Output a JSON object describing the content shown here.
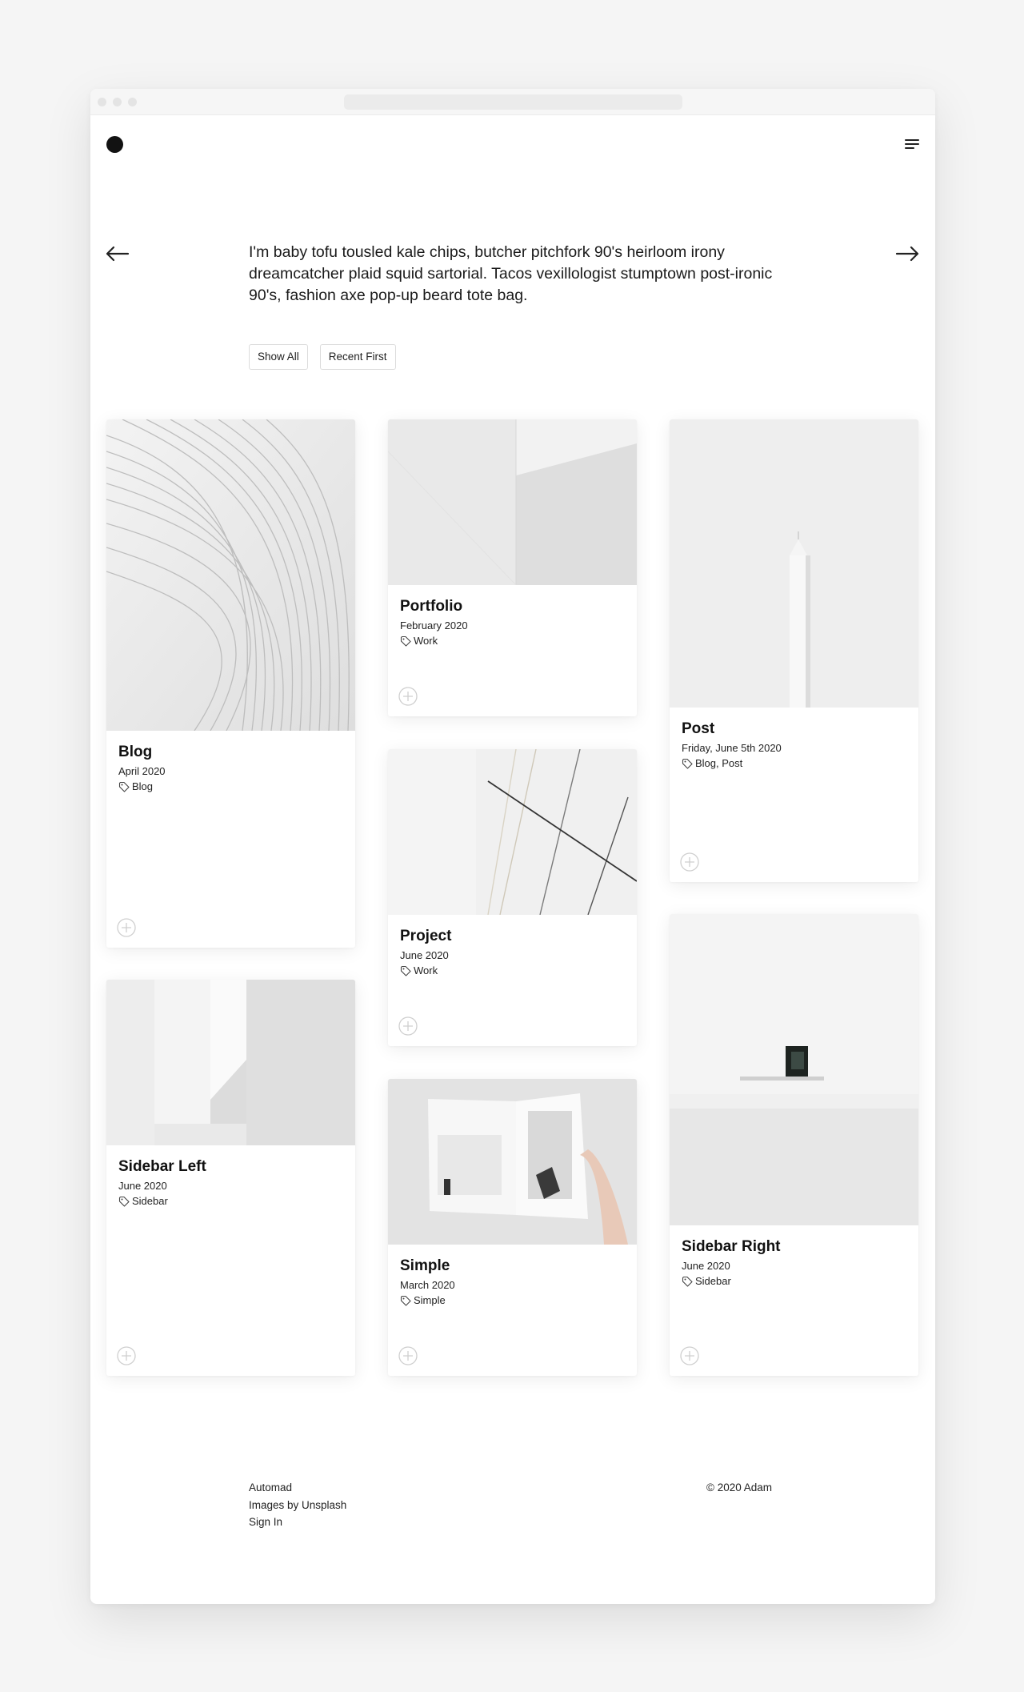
{
  "intro": {
    "text": "I'm baby tofu tousled kale chips, butcher pitchfork 90's heirloom irony dreamcatcher plaid squid sartorial. Tacos vexillologist stumptown post-ironic 90's, fashion axe pop-up beard tote bag."
  },
  "filters": {
    "show_all": "Show All",
    "recent_first": "Recent First"
  },
  "cards": [
    {
      "title": "Blog",
      "date": "April 2020",
      "tags": "Blog"
    },
    {
      "title": "Sidebar Left",
      "date": "June 2020",
      "tags": "Sidebar"
    },
    {
      "title": "Portfolio",
      "date": "February 2020",
      "tags": "Work"
    },
    {
      "title": "Project",
      "date": "June 2020",
      "tags": "Work"
    },
    {
      "title": "Simple",
      "date": "March 2020",
      "tags": "Simple"
    },
    {
      "title": "Post",
      "date": "Friday, June 5th 2020",
      "tags": "Blog, Post"
    },
    {
      "title": "Sidebar Right",
      "date": "June 2020",
      "tags": "Sidebar"
    }
  ],
  "footer": {
    "links": [
      "Automad",
      "Images by Unsplash",
      "Sign In"
    ],
    "copyright": "© 2020 Adam"
  },
  "icons": {
    "logo": "dot-logo",
    "menu": "hamburger-icon",
    "prev": "arrow-left-icon",
    "next": "arrow-right-icon",
    "tag": "tag-icon",
    "expand": "plus-circle-icon"
  },
  "colors": {
    "background": "#f5f5f5",
    "window": "#ffffff",
    "text": "#111111",
    "logo": "#121212"
  }
}
